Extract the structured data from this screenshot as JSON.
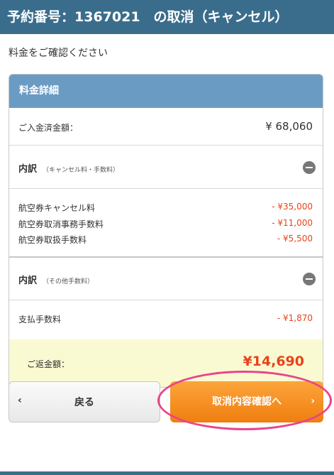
{
  "header": {
    "title": "予約番号：1367021　の取消（キャンセル）"
  },
  "subtitle": "料金をご確認ください",
  "card": {
    "title": "料金詳細",
    "deposit": {
      "label": "ご入金済金額：",
      "value": "¥ 68,060"
    },
    "section1": {
      "title": "内訳",
      "note": "（キャンセル料・手数料）",
      "items": [
        {
          "label": "航空券キャンセル料",
          "amount": "- ¥35,000"
        },
        {
          "label": "航空券取消事務手数料",
          "amount": "- ¥11,000"
        },
        {
          "label": "航空券取扱手数料",
          "amount": "- ¥5,500"
        }
      ]
    },
    "section2": {
      "title": "内訳",
      "note": "（その他手数料）",
      "items": [
        {
          "label": "支払手数料",
          "amount": "- ¥1,870"
        }
      ]
    },
    "refund": {
      "label": "ご返金額：",
      "value": "¥14,690"
    }
  },
  "buttons": {
    "back": {
      "label": "戻る",
      "icon": "chevron-left-icon"
    },
    "next": {
      "label": "取消内容確認へ",
      "icon": "chevron-right-icon"
    }
  },
  "colors": {
    "header": "#3a6d8c",
    "card_header": "#6a9bc3",
    "amount_red": "#e8431a",
    "next_button": "#f5901f",
    "highlight": "#e8458a"
  }
}
